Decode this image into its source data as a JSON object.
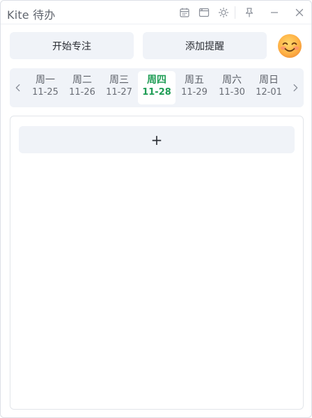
{
  "window": {
    "title": "Kite 待办",
    "controls": {
      "calendar_icon": "calendar-icon",
      "window_icon": "window-icon",
      "theme_icon": "sun-icon",
      "pin_icon": "pin-icon",
      "minimize_icon": "minimize-icon",
      "close_icon": "close-icon"
    }
  },
  "actions": {
    "focus_label": "开始专注",
    "reminder_label": "添加提醒",
    "avatar_emoji": "smiling-face-emoji"
  },
  "week": {
    "days": [
      {
        "name": "周一",
        "date": "11-25"
      },
      {
        "name": "周二",
        "date": "11-26"
      },
      {
        "name": "周三",
        "date": "11-27"
      },
      {
        "name": "周四",
        "date": "11-28",
        "active": true
      },
      {
        "name": "周五",
        "date": "11-29"
      },
      {
        "name": "周六",
        "date": "11-30"
      },
      {
        "name": "周日",
        "date": "12-01"
      }
    ]
  },
  "panel": {
    "add_label": "+"
  },
  "colors": {
    "accent": "#1f9d55",
    "button_bg": "#f0f3f8",
    "icon": "#8a8f99"
  }
}
